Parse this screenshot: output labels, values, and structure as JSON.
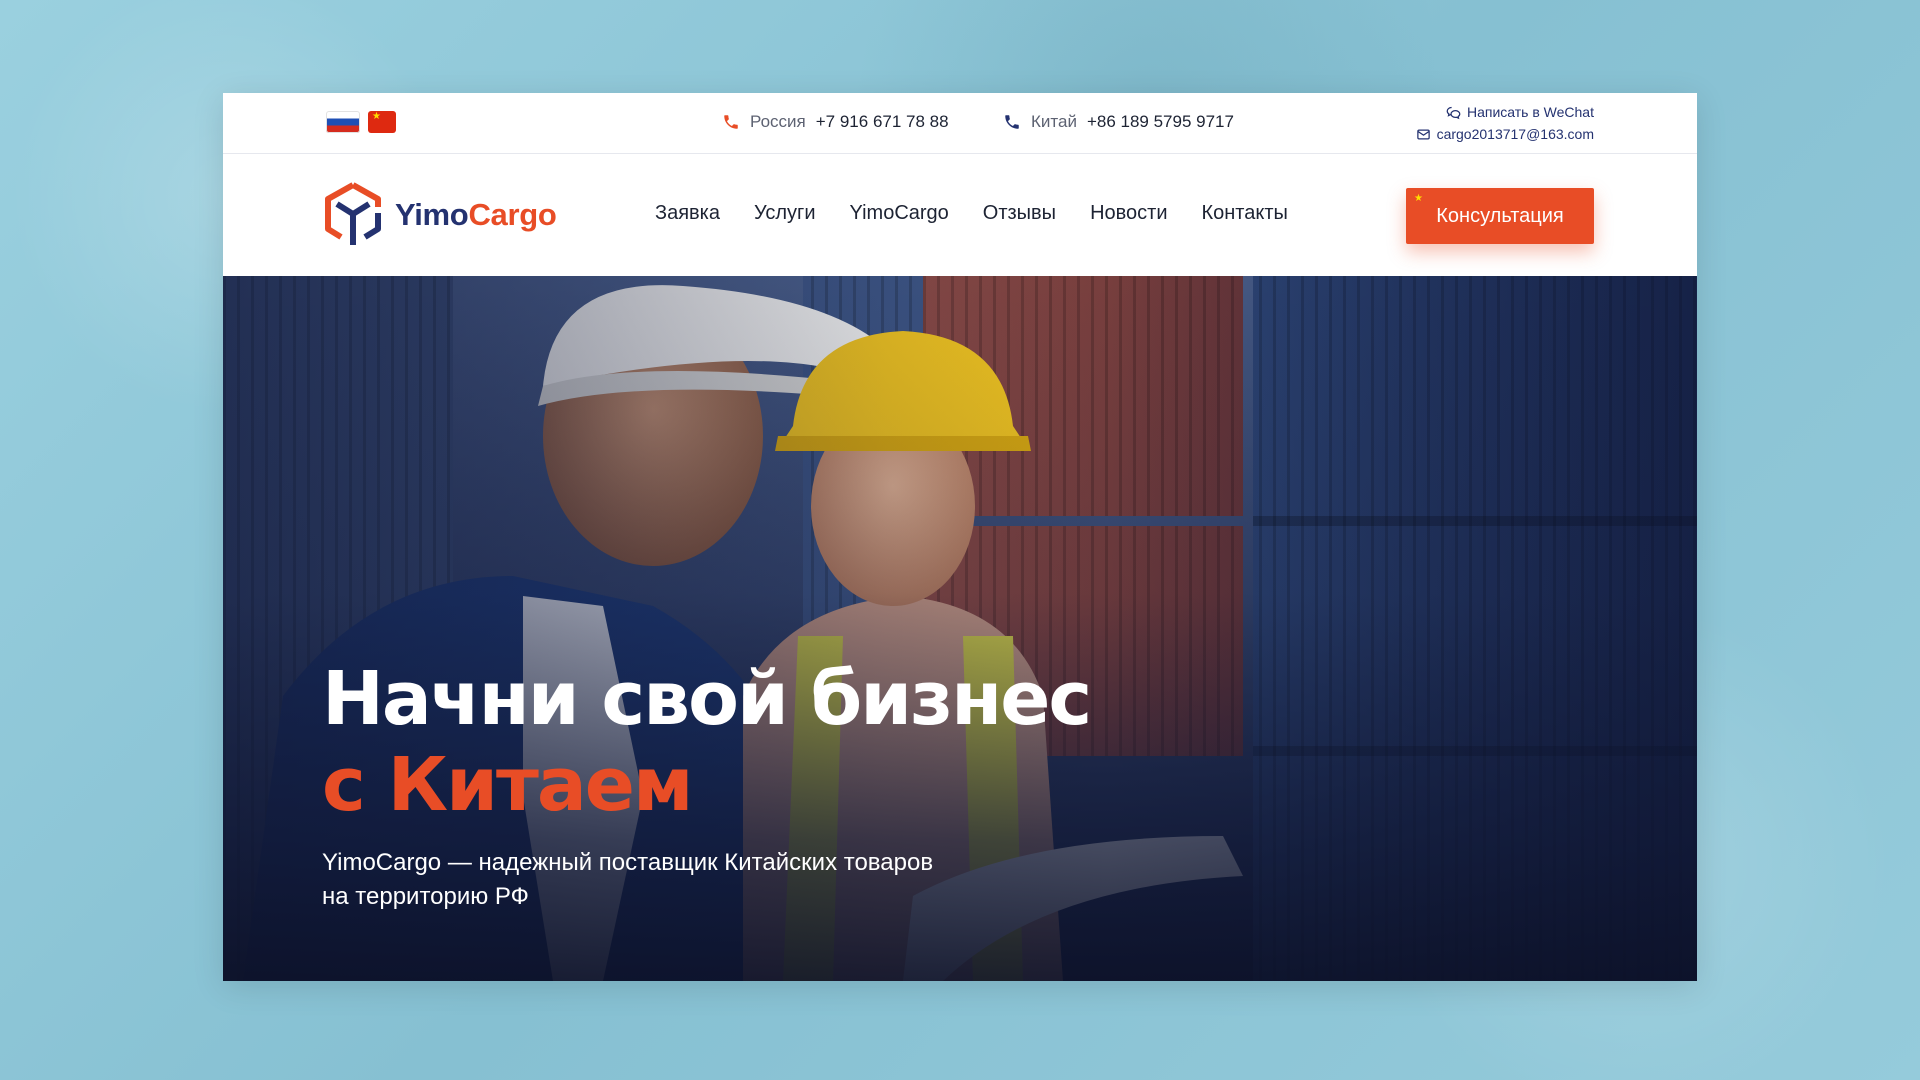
{
  "topbar": {
    "flags": [
      {
        "name": "russia-flag"
      },
      {
        "name": "china-flag"
      }
    ],
    "phones": [
      {
        "country": "Россия",
        "number": "+7 916 671 78 88",
        "icon_color": "#e84d26"
      },
      {
        "country": "Китай",
        "number": "+86 189 5795 9717",
        "icon_color": "#243270"
      }
    ],
    "wechat_label": "Написать в WeChat",
    "email": "cargo2013717@163.com"
  },
  "navbar": {
    "logo": {
      "part1": "Yimo",
      "part2": "Cargo"
    },
    "menu": [
      "Заявка",
      "Услуги",
      "YimoCargo",
      "Отзывы",
      "Новости",
      "Контакты"
    ],
    "cta_label": "Консультация"
  },
  "hero": {
    "title_line1": "Начни свой бизнес",
    "title_line2": "с Китаем",
    "subtitle": "YimoCargo — надежный поставщик Китайских товаров на территорию РФ"
  },
  "colors": {
    "brand_blue": "#243270",
    "brand_orange": "#e84d26",
    "page_backdrop": "#8fc8d8"
  }
}
